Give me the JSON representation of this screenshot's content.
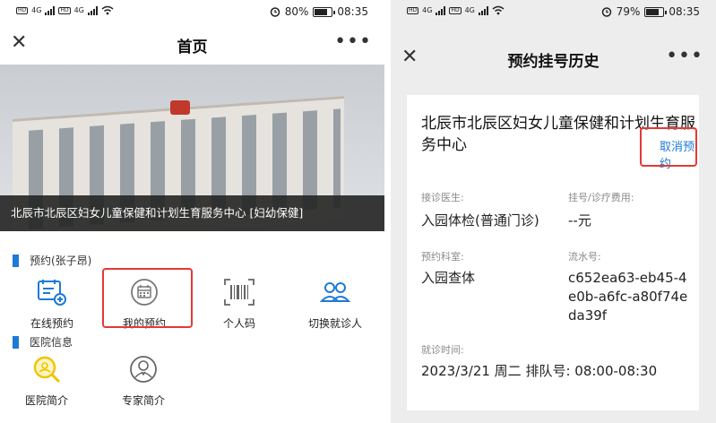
{
  "left": {
    "status": {
      "network": "4G",
      "battery_text": "80%",
      "time": "08:35",
      "battery_level": 0.8
    },
    "nav": {
      "title": "首页"
    },
    "banner": {
      "caption": "北辰市北辰区妇女儿童保健和计划生育服务中心 [妇幼保健]"
    },
    "appointment_section": {
      "heading": "预约(张子昂)",
      "items": [
        {
          "label": "在线预约",
          "icon": "calendar-plus-icon"
        },
        {
          "label": "我的预约",
          "icon": "calendar-grid-icon"
        },
        {
          "label": "个人码",
          "icon": "barcode-icon"
        },
        {
          "label": "切换就诊人",
          "icon": "users-icon"
        }
      ]
    },
    "hospital_section": {
      "heading": "医院信息",
      "items": [
        {
          "label": "医院简介",
          "icon": "hospital-search-icon"
        },
        {
          "label": "专家简介",
          "icon": "doctor-icon"
        }
      ]
    },
    "colors": {
      "accent": "#1d7bd6",
      "highlight": "#e53935",
      "icon_yellow": "#f2c200"
    }
  },
  "right": {
    "status": {
      "network": "4G",
      "battery_text": "79%",
      "time": "08:35",
      "battery_level": 0.79
    },
    "nav": {
      "title": "预约挂号历史"
    },
    "card": {
      "title": "北辰市北辰区妇女儿童保健和计划生育服务中心",
      "cancel_label": "取消预约",
      "doctor_label": "接诊医生:",
      "doctor_value": "入园体检(普通门诊)",
      "fee_label": "挂号/诊疗费用:",
      "fee_value": "--元",
      "dept_label": "预约科室:",
      "dept_value": "入园查体",
      "serial_label": "流水号:",
      "serial_value": "c652ea63-eb45-4e0b-a6fc-a80f74eda39f",
      "time_label": "就诊时间:",
      "time_value": "2023/3/21 周二 排队号: 08:00-08:30"
    }
  }
}
